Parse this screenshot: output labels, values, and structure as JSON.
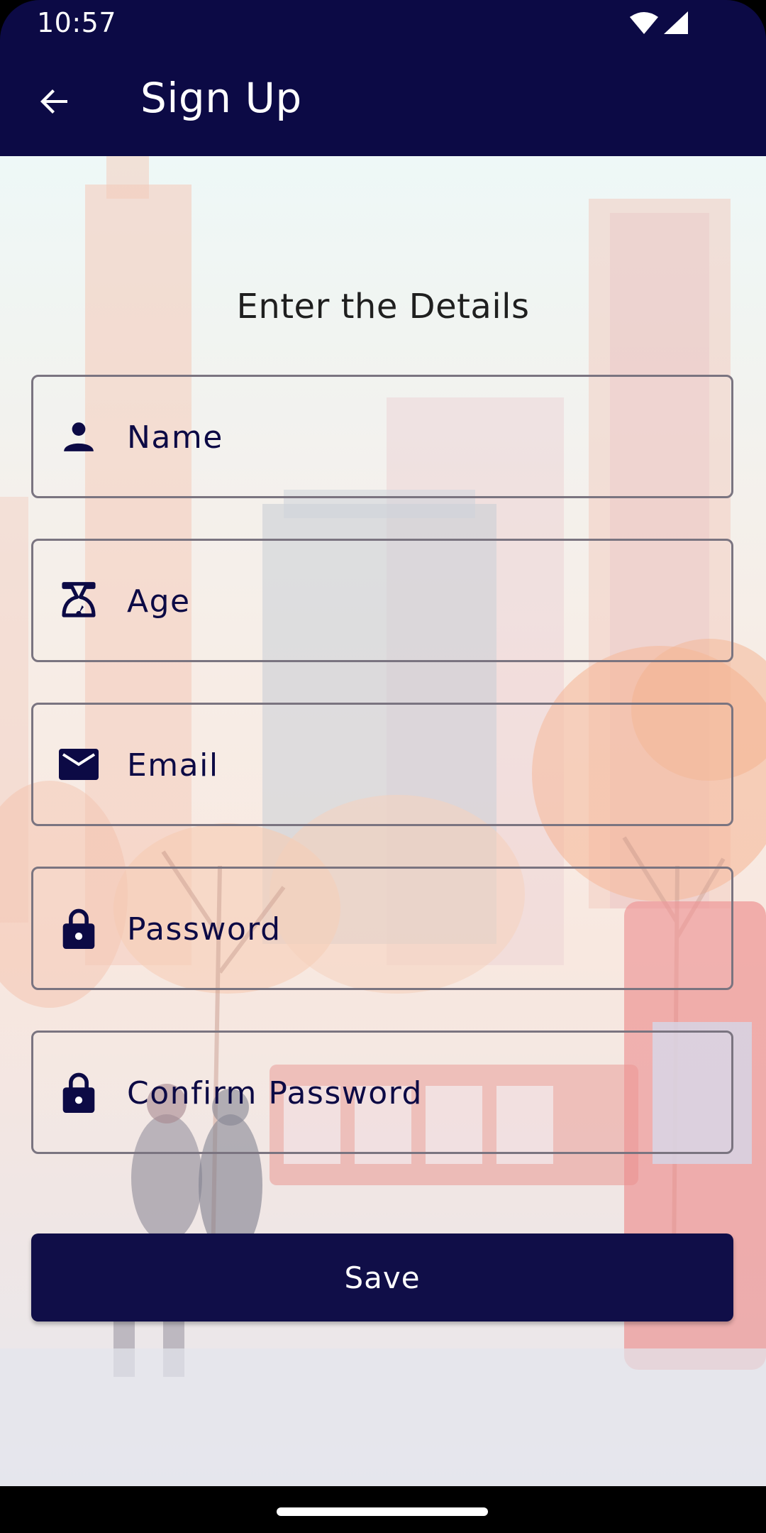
{
  "status": {
    "time": "10:57"
  },
  "appbar": {
    "title": "Sign Up"
  },
  "form": {
    "heading": "Enter the Details",
    "fields": [
      {
        "placeholder": "Name",
        "icon": "person-icon"
      },
      {
        "placeholder": "Age",
        "icon": "age-icon"
      },
      {
        "placeholder": "Email",
        "icon": "mail-icon"
      },
      {
        "placeholder": "Password",
        "icon": "lock-icon"
      },
      {
        "placeholder": "Confirm Password",
        "icon": "lock-icon"
      }
    ],
    "save_label": "Save"
  },
  "colors": {
    "primary": "#0c0a45",
    "text": "#1f1f1f"
  }
}
